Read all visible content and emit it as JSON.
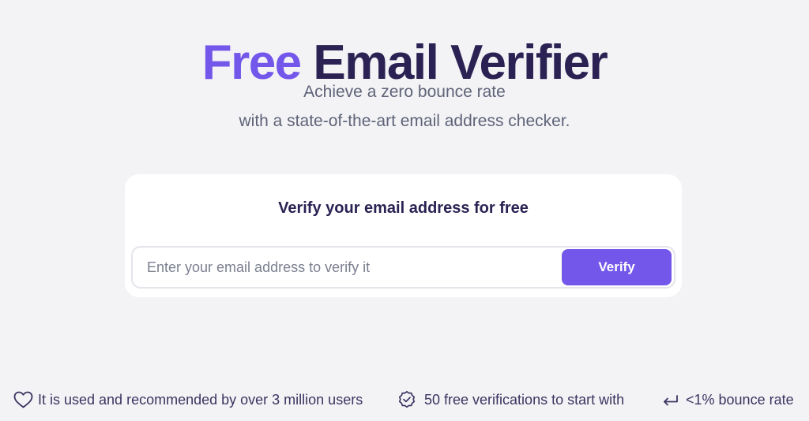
{
  "hero": {
    "title_accent": "Free",
    "title_rest": "Email Verifier",
    "subtitle_line1": "Achieve a zero bounce rate",
    "subtitle_line2": "with a state-of-the-art email address checker."
  },
  "card": {
    "title": "Verify your email address for free",
    "input_placeholder": "Enter your email address to verify it",
    "input_value": "",
    "button_label": "Verify"
  },
  "features": [
    {
      "icon": "heart-icon",
      "text": "It is used and recommended by over 3 million users"
    },
    {
      "icon": "badge-check-icon",
      "text": "50 free verifications to start with"
    },
    {
      "icon": "return-arrow-icon",
      "text": "<1% bounce rate"
    }
  ],
  "colors": {
    "accent": "#7357ea",
    "heading": "#2b2253",
    "background": "#f3f3f6",
    "card": "#ffffff"
  }
}
